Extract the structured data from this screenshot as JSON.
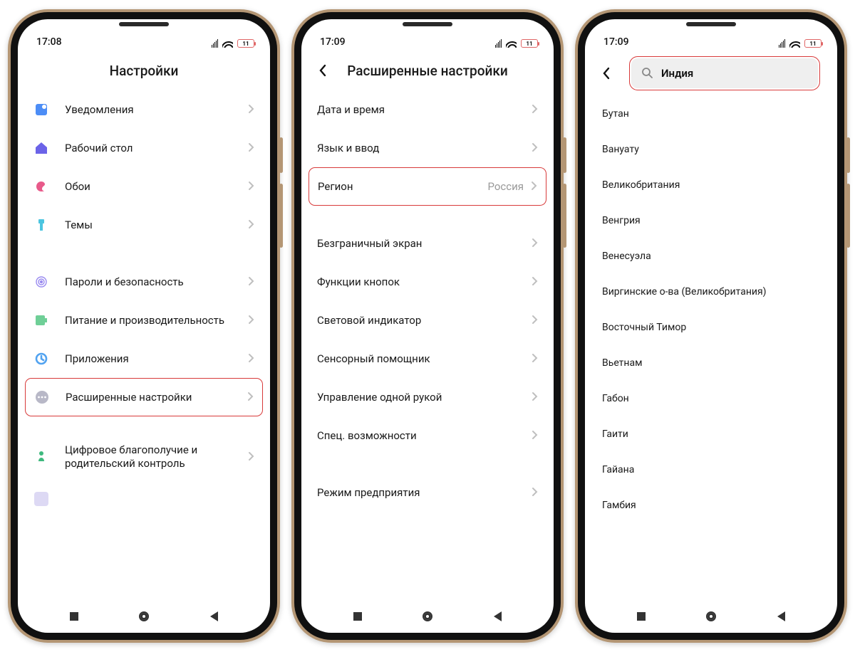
{
  "p1": {
    "time": "17:08",
    "batt": "11",
    "title": "Настройки",
    "items": [
      {
        "label": "Уведомления",
        "icon": "notifications",
        "color": "#4c8df6"
      },
      {
        "label": "Рабочий стол",
        "icon": "home",
        "color": "#6b63e8"
      },
      {
        "label": "Обои",
        "icon": "wallpaper",
        "color": "#e85a8a"
      },
      {
        "label": "Темы",
        "icon": "themes",
        "color": "#4cc5e0"
      }
    ],
    "items2": [
      {
        "label": "Пароли и безопасность",
        "icon": "fingerprint",
        "color": "#9a8bf0"
      },
      {
        "label": "Питание и производительность",
        "icon": "battery",
        "color": "#6fcf97"
      },
      {
        "label": "Приложения",
        "icon": "apps",
        "color": "#52a3f0"
      },
      {
        "label": "Расширенные настройки",
        "icon": "more",
        "color": "#b8b8c7",
        "hl": true
      }
    ],
    "items3": [
      {
        "label": "Цифровое благополучие и родительский контроль",
        "icon": "wellbeing",
        "color": "#3fb97e",
        "two": true
      }
    ]
  },
  "p2": {
    "time": "17:09",
    "batt": "11",
    "title": "Расширенные настройки",
    "g1": [
      {
        "label": "Дата и время"
      },
      {
        "label": "Язык и ввод"
      },
      {
        "label": "Регион",
        "value": "Россия",
        "hl": true
      }
    ],
    "g2": [
      {
        "label": "Безграничный экран"
      },
      {
        "label": "Функции кнопок"
      },
      {
        "label": "Световой индикатор"
      },
      {
        "label": "Сенсорный помощник"
      },
      {
        "label": "Управление одной рукой"
      },
      {
        "label": "Спец. возможности"
      }
    ],
    "g3": [
      {
        "label": "Режим предприятия"
      }
    ]
  },
  "p3": {
    "time": "17:09",
    "batt": "11",
    "search": "Индия",
    "list": [
      "Бутан",
      "Вануату",
      "Великобритания",
      "Венгрия",
      "Венесуэла",
      "Виргинские о-ва (Великобритания)",
      "Восточный Тимор",
      "Вьетнам",
      "Габон",
      "Гаити",
      "Гайана",
      "Гамбия"
    ]
  }
}
